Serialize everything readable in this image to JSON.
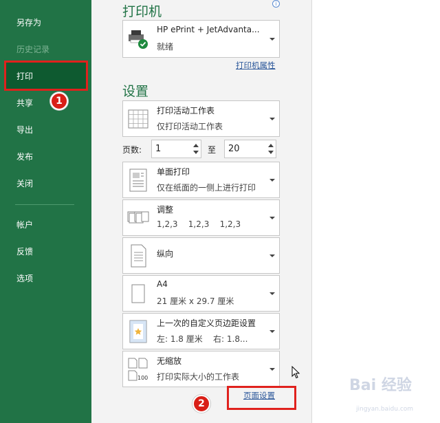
{
  "sidebar": {
    "items": [
      {
        "label": "另存为",
        "state": "normal"
      },
      {
        "label": "历史记录",
        "state": "disabled"
      },
      {
        "label": "打印",
        "state": "active"
      },
      {
        "label": "共享",
        "state": "normal"
      },
      {
        "label": "导出",
        "state": "normal"
      },
      {
        "label": "发布",
        "state": "normal"
      },
      {
        "label": "关闭",
        "state": "normal"
      },
      {
        "label": "帐户",
        "state": "normal"
      },
      {
        "label": "反馈",
        "state": "normal"
      },
      {
        "label": "选项",
        "state": "normal"
      }
    ]
  },
  "printer": {
    "heading": "打印机",
    "name": "HP ePrint + JetAdvanta...",
    "status": "就绪",
    "properties_link": "打印机属性"
  },
  "settings": {
    "heading": "设置",
    "scope": {
      "title": "打印活动工作表",
      "subtitle": "仅打印活动工作表"
    },
    "pages": {
      "label": "页数:",
      "from": "1",
      "to_label": "至",
      "to": "20"
    },
    "sides": {
      "title": "单面打印",
      "subtitle": "仅在纸面的一侧上进行打印"
    },
    "collate": {
      "title": "调整",
      "subtitle": "1,2,3    1,2,3    1,2,3"
    },
    "orientation": {
      "title": "纵向"
    },
    "paper": {
      "title": "A4",
      "subtitle": "21 厘米 x 29.7 厘米"
    },
    "margins": {
      "title": "上一次的自定义页边距设置",
      "subtitle": "左: 1.8 厘米    右: 1.8..."
    },
    "scaling": {
      "title": "无缩放",
      "subtitle": "打印实际大小的工作表",
      "icon_text": "100"
    },
    "page_setup_link": "页面设置"
  },
  "annotations": {
    "badge1": "1",
    "badge2": "2"
  },
  "watermark": {
    "text": "Bai 经验",
    "url": "jingyan.baidu.com"
  },
  "colors": {
    "sidebar": "#217346",
    "active": "#0e5a30",
    "accent": "#217346",
    "link": "#2b579a",
    "annotation": "#e0211d"
  }
}
